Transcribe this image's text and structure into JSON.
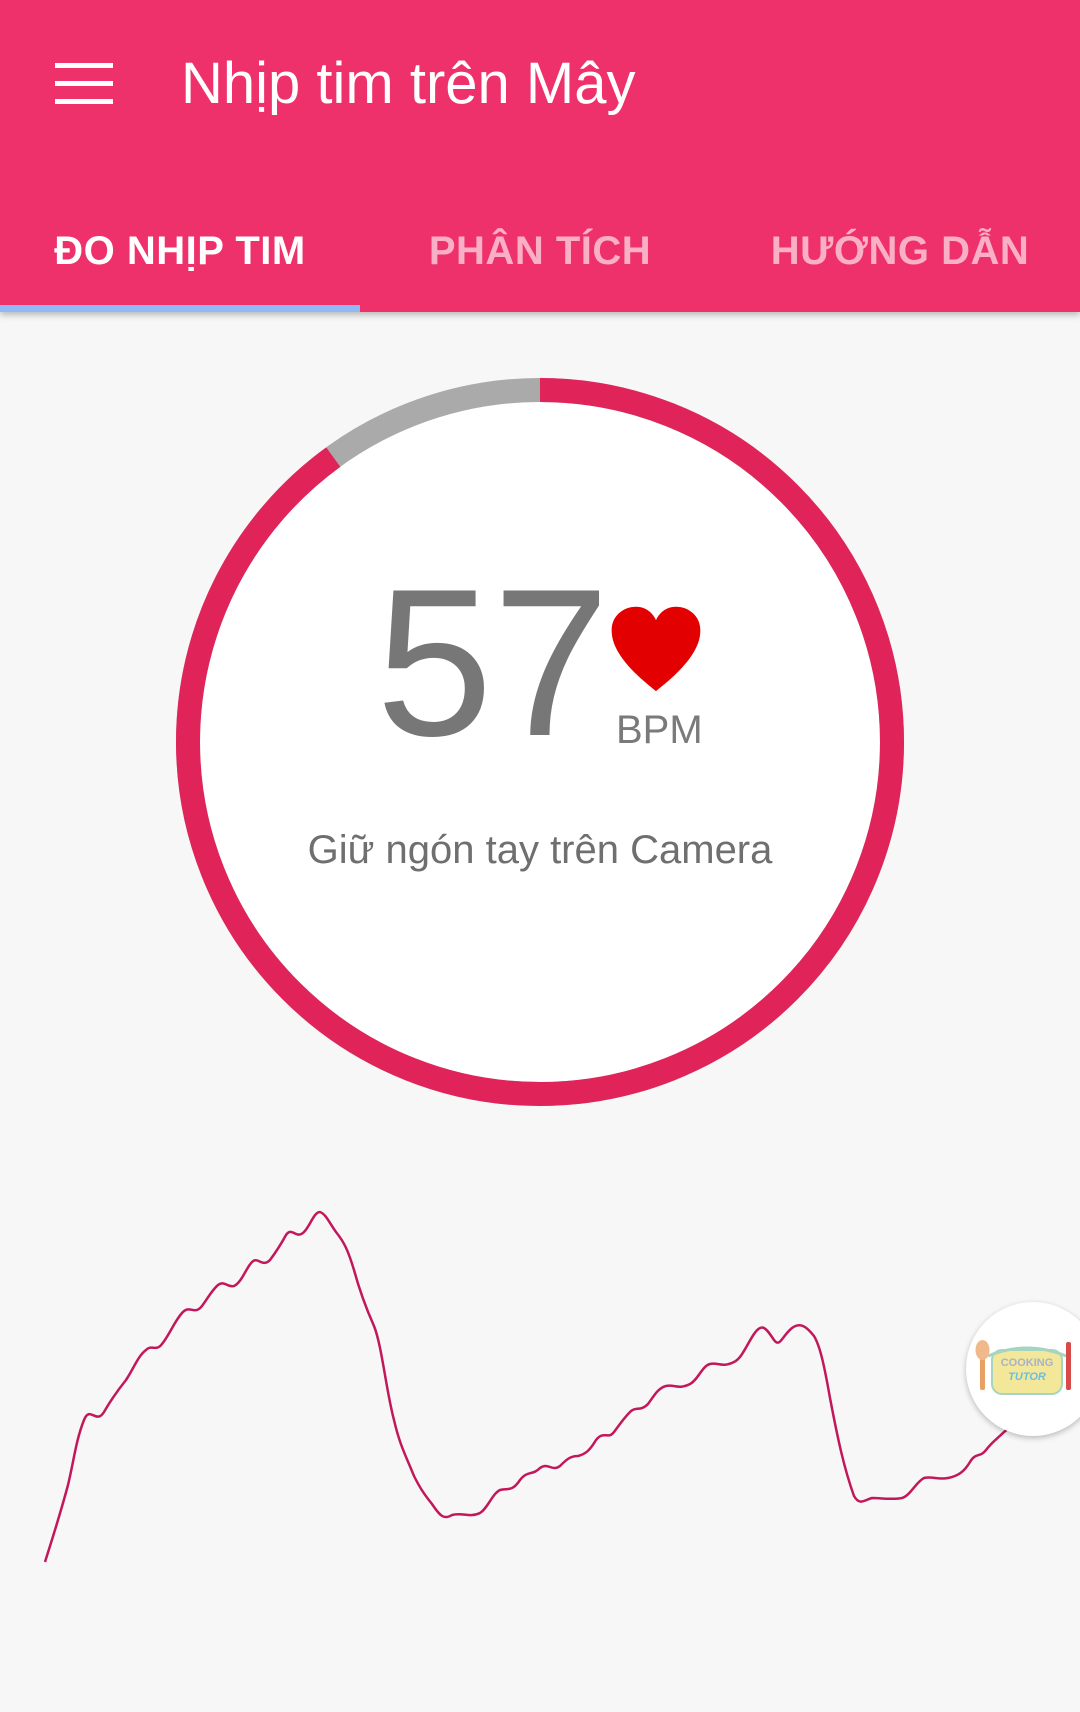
{
  "app": {
    "title": "Nhịp tim trên Mây",
    "colors": {
      "primary": "#ee306b",
      "accent_ring": "#e0245a",
      "ring_track": "#aaaaaa",
      "heart": "#e30000",
      "tab_indicator": "#8fb8f6"
    }
  },
  "tabs": [
    {
      "label": "ĐO NHỊP TIM",
      "active": true
    },
    {
      "label": "PHÂN TÍCH",
      "active": false
    },
    {
      "label": "HƯỚNG DẪN",
      "active": false
    }
  ],
  "measurement": {
    "bpm": "57",
    "unit": "BPM",
    "hint": "Giữ ngón tay trên Camera",
    "progress": 0.9
  },
  "icons": {
    "menu": "menu-icon",
    "heart": "heart-icon",
    "fab": "cooking-tutor-logo"
  },
  "fab": {
    "logo_text_line1": "COOKING",
    "logo_text_line2": "TUTOR"
  }
}
